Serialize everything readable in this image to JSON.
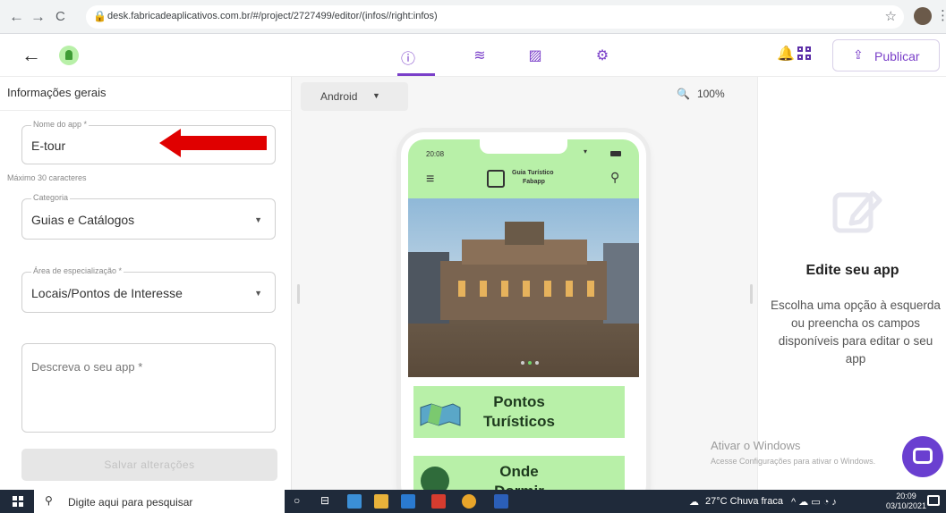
{
  "browser": {
    "url": "desk.fabricadeaplicativos.com.br/#/project/2727499/editor/(infos//right:infos)",
    "back_icon": "←",
    "forward_icon": "→",
    "reload_icon": "C",
    "star_icon": "☆"
  },
  "header": {
    "back_icon": "←",
    "tabs": [
      {
        "icon": "info-icon",
        "glyph": "ⓘ"
      },
      {
        "icon": "layers-icon",
        "glyph": "≋"
      },
      {
        "icon": "image-icon",
        "glyph": "▨"
      },
      {
        "icon": "gear-icon",
        "glyph": "⚙"
      }
    ],
    "bell_icon": "🔔",
    "publish_label": "Publicar",
    "publish_icon": "⇪"
  },
  "left_panel": {
    "title": "Informações gerais",
    "app_name": {
      "label": "Nome do app *",
      "value": "E-tour",
      "helper": "Máximo 30 caracteres"
    },
    "category": {
      "label": "Categoria",
      "value": "Guias e Catálogos"
    },
    "area": {
      "label": "Área de especialização *",
      "value": "Locais/Pontos de Interesse"
    },
    "description": {
      "placeholder": "Descreva o seu app *"
    },
    "save_label": "Salvar alterações"
  },
  "preview": {
    "platform": "Android",
    "zoom": "100%",
    "zoom_icon": "🔍",
    "phone": {
      "time": "20:08",
      "title_line1": "Guia Turístico",
      "title_line2": "Fabapp",
      "cards": [
        {
          "title_line1": "Pontos",
          "title_line2": "Turísticos"
        },
        {
          "title_line1": "Onde",
          "title_line2": "Dormir"
        }
      ]
    }
  },
  "right_panel": {
    "title": "Edite seu app",
    "description": "Escolha uma opção à esquerda ou preencha os campos disponíveis para editar o seu app"
  },
  "watermark": {
    "line1": "Ativar o Windows",
    "line2": "Acesse Configurações para ativar o Windows."
  },
  "taskbar": {
    "search_placeholder": "Digite aqui para pesquisar",
    "weather": "27°C  Chuva fraca",
    "time": "20:09",
    "date": "03/10/2021"
  },
  "colors": {
    "accent": "#7a3fc9",
    "app_green": "#b8f0a8",
    "arrow_red": "#e00000"
  }
}
